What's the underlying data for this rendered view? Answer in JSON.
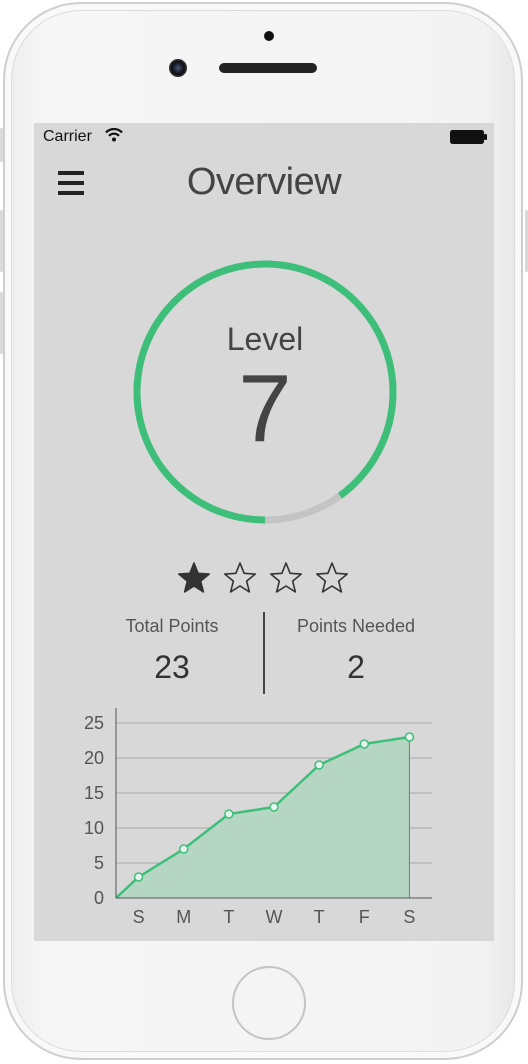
{
  "status_bar": {
    "carrier": "Carrier"
  },
  "header": {
    "title": "Overview",
    "menu_icon": "hamburger-menu-icon"
  },
  "level": {
    "label": "Level",
    "value": "7",
    "progress": 0.9,
    "progress_color": "#3dbf7a",
    "track_color": "#c4c4c4"
  },
  "stars": {
    "filled": 1,
    "total": 4
  },
  "stats": {
    "total_points_label": "Total Points",
    "total_points_value": "23",
    "points_needed_label": "Points Needed",
    "points_needed_value": "2"
  },
  "colors": {
    "accent": "#3dbf7a",
    "area_fill": "#b4d6c3",
    "screen_bg": "#d8d8d8"
  },
  "chart_data": {
    "type": "area",
    "categories": [
      "S",
      "M",
      "T",
      "W",
      "T",
      "F",
      "S"
    ],
    "x": [
      0,
      0.5,
      1.5,
      2.5,
      3.5,
      4.5,
      5.5,
      6.5
    ],
    "values": [
      0,
      3,
      7,
      12,
      13,
      19,
      22,
      23
    ],
    "ylim": [
      0,
      25
    ],
    "yticks": [
      0,
      5,
      10,
      15,
      20,
      25
    ],
    "grid": true,
    "title": "",
    "xlabel": "",
    "ylabel": ""
  }
}
